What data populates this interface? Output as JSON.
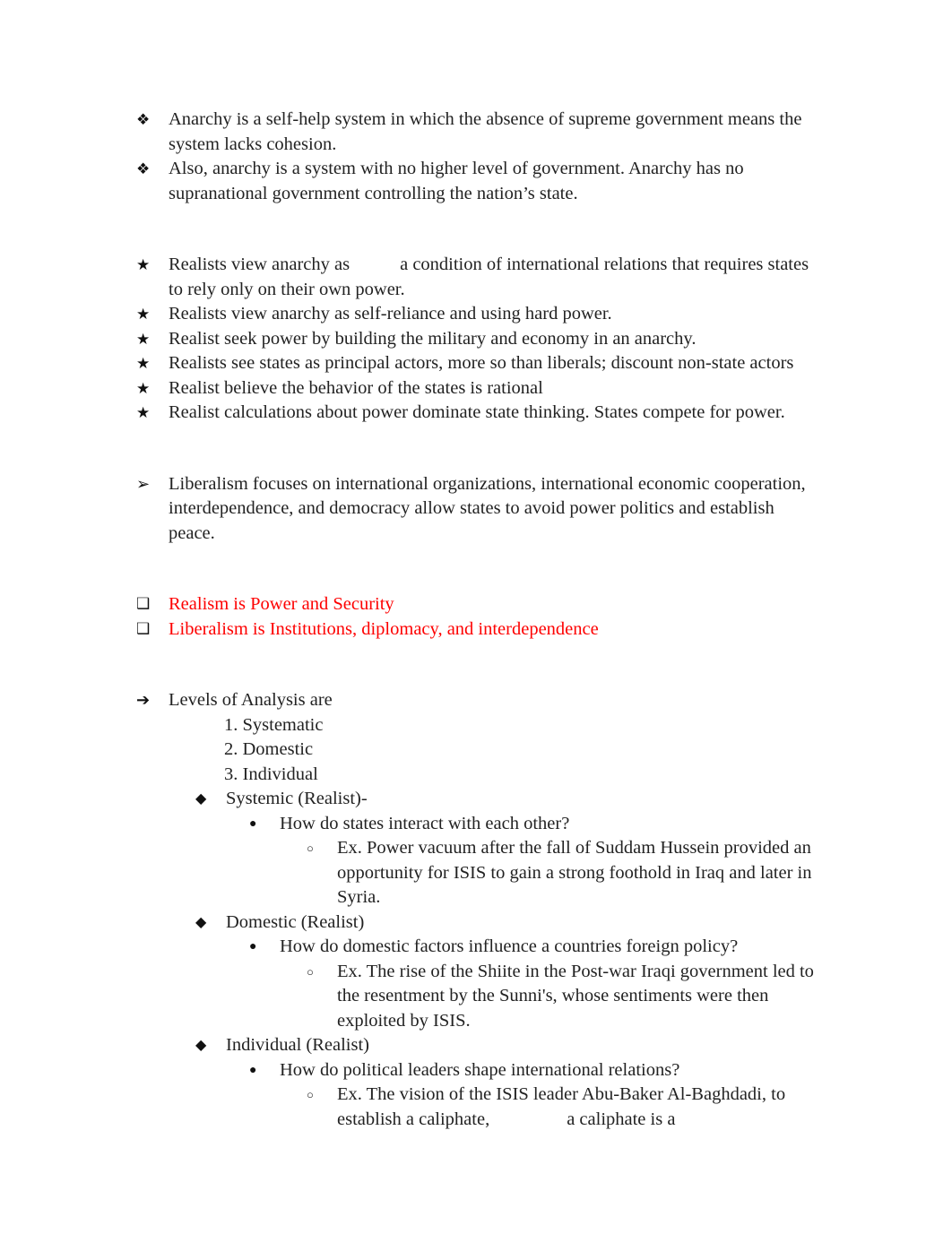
{
  "document": {
    "title": "International Relations Notes",
    "text_color": "#222222",
    "highlight_color": "#fe0000"
  },
  "bullets": {
    "flower": "❖",
    "star": "★",
    "arrowhead": "➢",
    "arrow": "➔",
    "square": "❑",
    "diamond": "◆",
    "dot": "●",
    "circle": "○"
  },
  "sections": {
    "anarchy": [
      "Anarchy is a self-help system in which the absence of supreme government means the system lacks cohesion.",
      "Also, anarchy is a system with no higher level of government. Anarchy has no supranational government controlling the nation’s state."
    ],
    "realism": {
      "first_item_lead": "Realists view anarchy as",
      "first_item_rest": "a condition of international relations that requires states to rely only on their own power.",
      "items": [
        "Realists view anarchy as self-reliance and using hard power.",
        "Realist seek power by building the military and economy in an anarchy.",
        "Realists see states as principal actors, more so than liberals; discount non-state actors",
        "Realist believe the behavior of the states is rational",
        "Realist calculations about power dominate state thinking. States compete for power."
      ]
    },
    "liberalism": {
      "text": "Liberalism focuses on international organizations, international economic cooperation, interdependence, and democracy allow states to avoid power politics and establish peace."
    },
    "key_points": [
      "Realism is Power and Security",
      "Liberalism is Institutions, diplomacy, and interdependence"
    ],
    "levels_of_analysis": {
      "heading": "Levels of Analysis are",
      "numbered": [
        "1. Systematic",
        "2. Domestic",
        "3. Individual"
      ],
      "groups": [
        {
          "label": "Systemic (Realist)-",
          "question": "How do states interact with each other?",
          "example": "Ex. Power vacuum after the fall of Suddam Hussein provided an opportunity for ISIS to gain a strong foothold in Iraq and later in Syria."
        },
        {
          "label": "Domestic (Realist)",
          "question": "How do domestic factors influence a countries foreign policy?",
          "example": "Ex. The rise of the Shiite in the Post-war Iraqi government led to the resentment by the Sunni's, whose sentiments were then exploited by ISIS."
        },
        {
          "label": "Individual (Realist)",
          "question": "How do political leaders shape international relations?",
          "example_lead": "Ex. The vision of the ISIS leader Abu-Baker Al-Baghdadi, to establish a caliphate,",
          "example_rest": "a caliphate is a"
        }
      ]
    }
  }
}
